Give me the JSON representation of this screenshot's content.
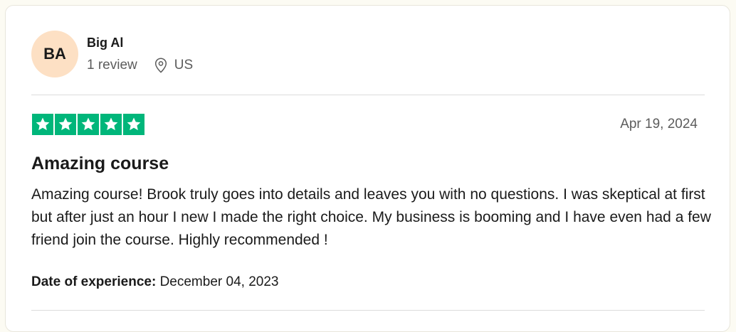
{
  "reviewer": {
    "initials": "BA",
    "name": "Big Al",
    "review_count": "1 review",
    "location": "US",
    "avatar_color": "#fde0c4",
    "location_icon": "map-pin-icon"
  },
  "review": {
    "rating": 5,
    "rating_max": 5,
    "star_color": "#00b67a",
    "date": "Apr 19, 2024",
    "title": "Amazing course",
    "body": "Amazing course! Brook truly goes into details and leaves you with no questions. I was skeptical at first but after just an hour I new I made the right choice. My business is booming and I have even had a few friend join the course. Highly recommended !",
    "experience_label": "Date of experience:",
    "experience_date": "December 04, 2023"
  }
}
